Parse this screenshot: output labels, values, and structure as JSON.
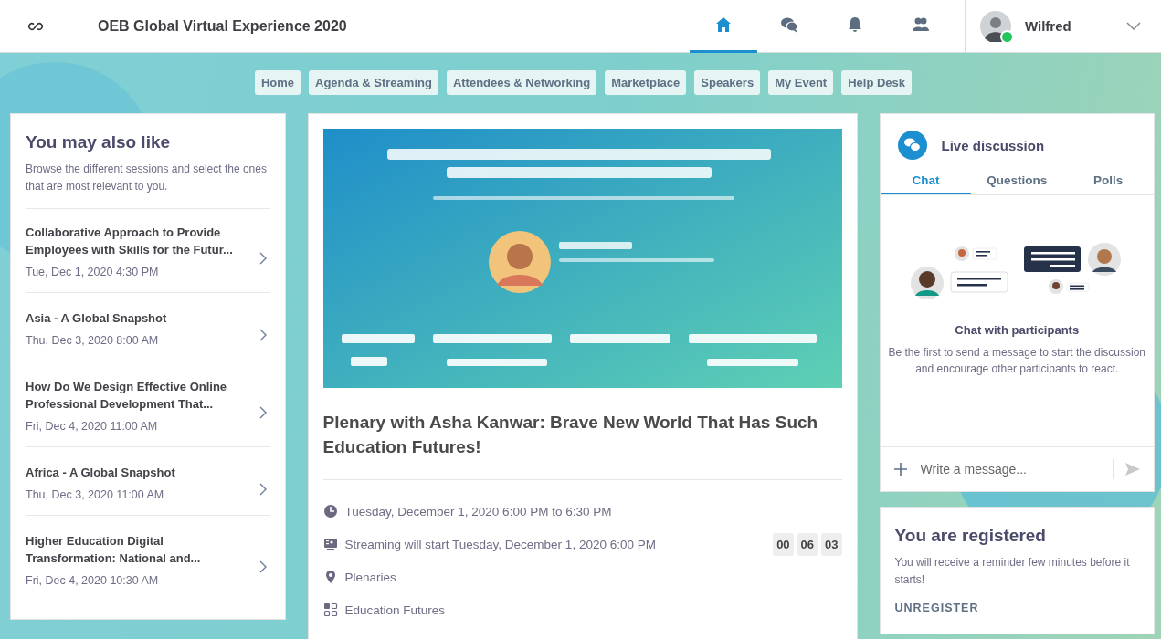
{
  "header": {
    "title": "OEB Global Virtual Experience 2020",
    "icons": [
      {
        "kind": "home",
        "selected": true
      },
      {
        "kind": "chat",
        "selected": false
      },
      {
        "kind": "bell",
        "selected": false
      },
      {
        "kind": "people",
        "selected": false
      }
    ],
    "user": {
      "name": "Wilfred",
      "online": true
    }
  },
  "nav": [
    "Home",
    "Agenda & Streaming",
    "Attendees & Networking",
    "Marketplace",
    "Speakers",
    "My Event",
    "Help Desk"
  ],
  "suggestions": {
    "title": "You may also like",
    "subtitle": "Browse the different sessions and select the ones that are most relevant to you.",
    "items": [
      {
        "title": "Collaborative Approach to Provide Employees with Skills for the Futur...",
        "date": "Tue, Dec 1, 2020 4:30 PM"
      },
      {
        "title": "Asia - A Global Snapshot",
        "date": "Thu, Dec 3, 2020 8:00 AM"
      },
      {
        "title": "How Do We Design Effective Online Professional Development That...",
        "date": "Fri, Dec 4, 2020 11:00 AM"
      },
      {
        "title": "Africa - A Global Snapshot",
        "date": "Thu, Dec 3, 2020 11:00 AM"
      },
      {
        "title": "Higher Education Digital Transformation: National and...",
        "date": "Fri, Dec 4, 2020 10:30 AM"
      }
    ]
  },
  "session": {
    "title": "Plenary with Asha Kanwar: Brave New World That Has Such Education Futures!",
    "details": [
      {
        "kind": "clock",
        "text": "Tuesday, December 1, 2020 6:00 PM to 6:30 PM"
      },
      {
        "kind": "stream",
        "text": "Streaming will start Tuesday, December 1, 2020 6:00 PM",
        "countdown": [
          "00",
          "06",
          "03"
        ]
      },
      {
        "kind": "location",
        "text": "Plenaries"
      },
      {
        "kind": "category",
        "text": "Education Futures"
      }
    ]
  },
  "discussion": {
    "title": "Live discussion",
    "tabs": [
      {
        "label": "Chat",
        "selected": true
      },
      {
        "label": "Questions",
        "selected": false
      },
      {
        "label": "Polls",
        "selected": false
      }
    ],
    "empty_title": "Chat with participants",
    "empty_text": "Be the first to send a message to start the discussion and encourage other participants to react.",
    "input": {
      "placeholder": "Write a message..."
    }
  },
  "registration": {
    "title": "You are registered",
    "text": "You will receive a reminder few minutes before it starts!",
    "action": "UNREGISTER"
  }
}
